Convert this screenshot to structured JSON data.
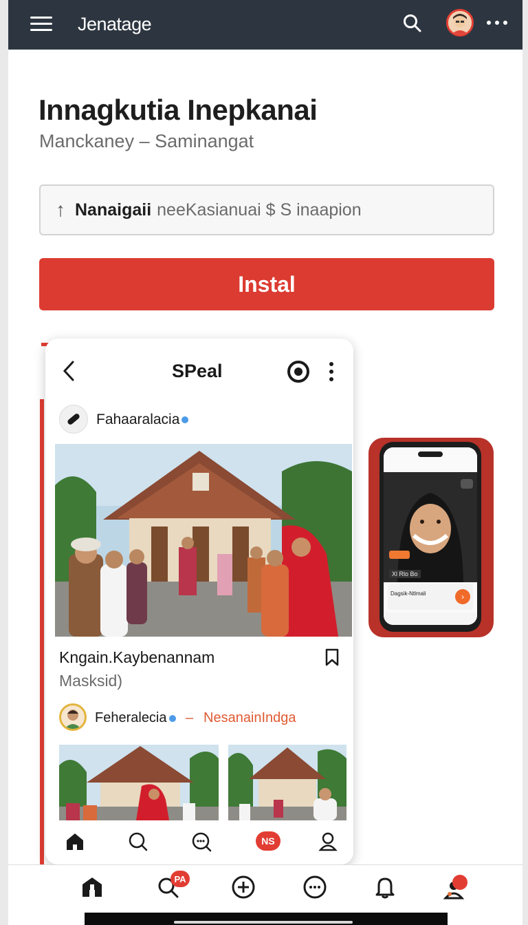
{
  "header": {
    "app_title": "Jenatage",
    "icons": [
      "menu-icon",
      "search-icon",
      "avatar",
      "more-icon"
    ]
  },
  "listing": {
    "title": "Innagkutia Inepkanai",
    "subtitle": "Manckaney – Saminangat",
    "notice_bold": "Nanaigaii",
    "notice_rest": "neeKasianuai $ S inaapion",
    "install_label": "Instal"
  },
  "preview": {
    "screen_title": "SPeal",
    "post_author": "Fahaaralacia",
    "caption_line1": "Kngain.Kaybenannam",
    "caption_line2": "Masksid)",
    "comment_author": "Feheralecia",
    "comment_separator": "–",
    "comment_tag": "NesanainIndga",
    "nav_badge": "NS"
  },
  "side_preview": {
    "ad_label": "Xl Rlo Bo",
    "banner_text": "Dagsik-Ntlmali"
  },
  "bottom_nav": {
    "items": [
      "home-icon",
      "search-icon",
      "add-icon",
      "chat-icon",
      "bell-icon",
      "profile-icon"
    ],
    "search_badge": "PA"
  },
  "colors": {
    "topbar": "#2d3640",
    "accent": "#dc3b31",
    "tag_orange": "#e05a32",
    "verified_blue": "#4d9be8"
  }
}
